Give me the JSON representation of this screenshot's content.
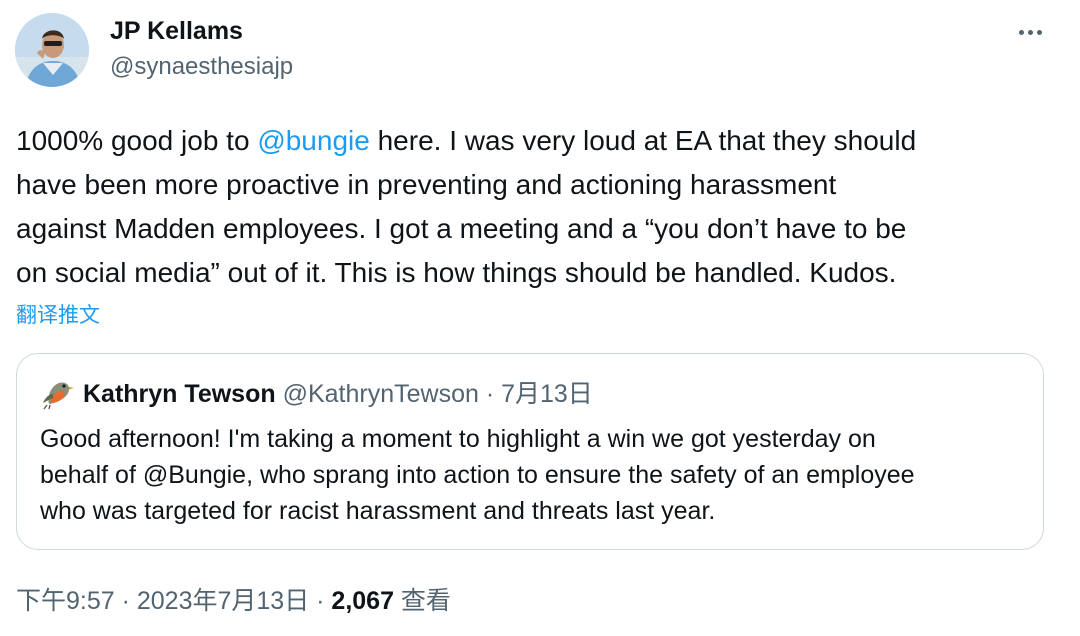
{
  "author": {
    "name": "JP Kellams",
    "handle": "@synaesthesiajp"
  },
  "tweet": {
    "line1_pre": "1000% good job to ",
    "line1_mention": "@bungie",
    "line1_post": " here. I was very loud at EA that they should",
    "line2": "have been more proactive in preventing and actioning harassment",
    "line3": "against Madden employees. I got a meeting and a “you don’t have to be",
    "line4": "on social media” out of it. This is how things should be handled. Kudos.",
    "translate_label": "翻译推文"
  },
  "quote": {
    "name": "Kathryn Tewson",
    "handle_date": " @KathrynTewson · 7月13日",
    "line1": "Good afternoon! I'm taking a moment to highlight a win we got yesterday on",
    "line2": "behalf of @Bungie, who sprang into action to ensure the safety of an employee",
    "line3": "who was targeted for racist harassment and threats last year."
  },
  "footer": {
    "time_date": "下午9:57 · 2023年7月13日 · ",
    "views_count": "2,067",
    "views_label": " 查看"
  },
  "colors": {
    "accent": "#1d9bf0",
    "text": "#0f1419",
    "secondary": "#536471",
    "border": "#cfd9de"
  },
  "icons": {
    "more": "more-horizontal-icon",
    "quote_avatar": "robin-bird-icon"
  }
}
